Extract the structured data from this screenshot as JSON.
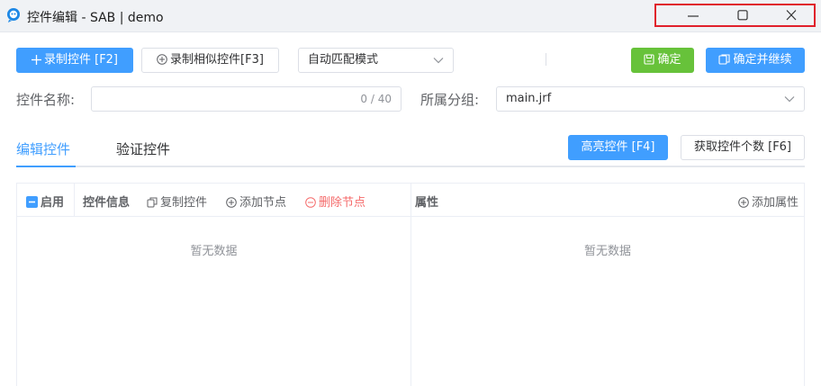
{
  "window": {
    "title": "控件编辑 - SAB | demo",
    "controls": [
      "minimize-icon",
      "maximize-icon",
      "close-icon"
    ],
    "highlight_color": "#e0202b"
  },
  "toolbar": {
    "record_label": "录制控件 [F2]",
    "record_similar_label": "录制相似控件[F3]",
    "match_mode_value": "自动匹配模式",
    "confirm_label": "确定",
    "confirm_continue_label": "确定并继续"
  },
  "form": {
    "name_label": "控件名称:",
    "name_value": "",
    "name_counter": "0 / 40",
    "group_label": "所属分组:",
    "group_value": "main.jrf"
  },
  "tabs": [
    {
      "label": "编辑控件",
      "active": true
    },
    {
      "label": "验证控件",
      "active": false
    }
  ],
  "tab_actions": {
    "highlight_label": "高亮控件 [F4]",
    "count_label": "获取控件个数 [F6]"
  },
  "left_panel": {
    "enable_label": "启用",
    "enabled": true,
    "info_label": "控件信息",
    "copy_label": "复制控件",
    "add_node_label": "添加节点",
    "delete_node_label": "删除节点",
    "empty_text": "暂无数据"
  },
  "right_panel": {
    "title": "属性",
    "add_attr_label": "添加属性",
    "empty_text": "暂无数据"
  },
  "colors": {
    "primary": "#409eff",
    "success": "#67c23a",
    "danger": "#f56c6c"
  }
}
